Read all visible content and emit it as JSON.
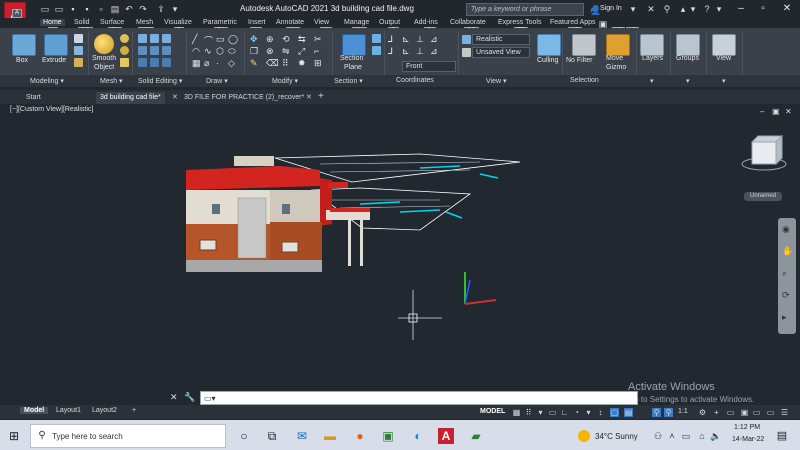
{
  "app": {
    "title": "Autodesk AutoCAD 2021   3d building cad file.dwg",
    "logo_letter": "A",
    "search_placeholder": "Type a keyword or phrase",
    "sign_in": "Sign In"
  },
  "ribbon_tabs": [
    {
      "label": "Home",
      "key": "H",
      "active": true
    },
    {
      "label": "Solid",
      "key": "SO"
    },
    {
      "label": "Surface",
      "key": "SU"
    },
    {
      "label": "Mesh",
      "key": "MM"
    },
    {
      "label": "Visualize",
      "key": "R"
    },
    {
      "label": "Parametric",
      "key": "PA"
    },
    {
      "label": "Insert",
      "key": "IN"
    },
    {
      "label": "Annotate",
      "key": "AN"
    },
    {
      "label": "View",
      "key": "VI"
    },
    {
      "label": "Manage",
      "key": "MA"
    },
    {
      "label": "Output",
      "key": "O"
    },
    {
      "label": "Add-ins",
      "key": "GI"
    },
    {
      "label": "Collaborate",
      "key": "CO"
    },
    {
      "label": "Express Tools",
      "key": "ET"
    },
    {
      "label": "Featured Apps",
      "key": "AP"
    }
  ],
  "ribbon": {
    "box": "Box",
    "extrude": "Extrude",
    "smooth_object_1": "Smooth",
    "smooth_object_2": "Object",
    "section_plane_1": "Section",
    "section_plane_2": "Plane",
    "visual_style": "Realistic",
    "saved_view": "Unsaved View",
    "view_front": "Front",
    "culling": "Culling",
    "no_filter": "No Filter",
    "move_gizmo_1": "Move",
    "move_gizmo_2": "Gizmo",
    "layers": "Layers",
    "groups": "Groups",
    "view": "View",
    "keytips": [
      "X2",
      "X3"
    ]
  },
  "panels": [
    {
      "label": "Modeling ▾"
    },
    {
      "label": "Mesh ▾"
    },
    {
      "label": "Solid Editing ▾"
    },
    {
      "label": "Draw ▾"
    },
    {
      "label": "Modify ▾"
    },
    {
      "label": "Section ▾"
    },
    {
      "label": "Coordinates"
    },
    {
      "label": "View ▾"
    },
    {
      "label": "Selection"
    }
  ],
  "doc_tabs": [
    {
      "label": "Start"
    },
    {
      "label": "3d building cad file*",
      "active": true
    },
    {
      "label": "3D FILE FOR PRACTICE (2)_recover*"
    }
  ],
  "viewport": {
    "label": "[−][Custom View][Realistic]",
    "viewcube_face": "FRONT",
    "wcs_label": "Unnamed"
  },
  "layout_tabs": [
    {
      "label": "Model",
      "active": true
    },
    {
      "label": "Layout1"
    },
    {
      "label": "Layout2"
    }
  ],
  "status": {
    "model": "MODEL",
    "scale": "1:1"
  },
  "watermark": {
    "line1": "Activate Windows",
    "line2": "Go to Settings to activate Windows."
  },
  "taskbar": {
    "search": "Type here to search",
    "weather": "34°C  Sunny",
    "time": "1:12 PM",
    "date": "14-Mar-22"
  },
  "colors": {
    "accent_red": "#c8202f",
    "ribbon_bg": "#3a414a",
    "viewport_bg": "#212830",
    "selection_cyan": "#00d6f0"
  }
}
